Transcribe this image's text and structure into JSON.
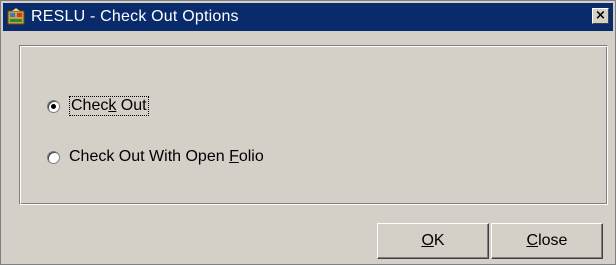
{
  "window": {
    "title": "RESLU - Check Out Options",
    "close_glyph": "×",
    "icon": "app-icon"
  },
  "options": [
    {
      "pre": "Chec",
      "mnemonic": "k",
      "post": " Out",
      "selected": true
    },
    {
      "pre": "Check Out With Open ",
      "mnemonic": "F",
      "post": "olio",
      "selected": false
    }
  ],
  "buttons": {
    "ok": {
      "pre": "",
      "mnemonic": "O",
      "post": "K"
    },
    "close": {
      "pre": "",
      "mnemonic": "C",
      "post": "lose"
    }
  },
  "colors": {
    "titlebar": "#0a2b6b",
    "face": "#d4d0c8"
  }
}
